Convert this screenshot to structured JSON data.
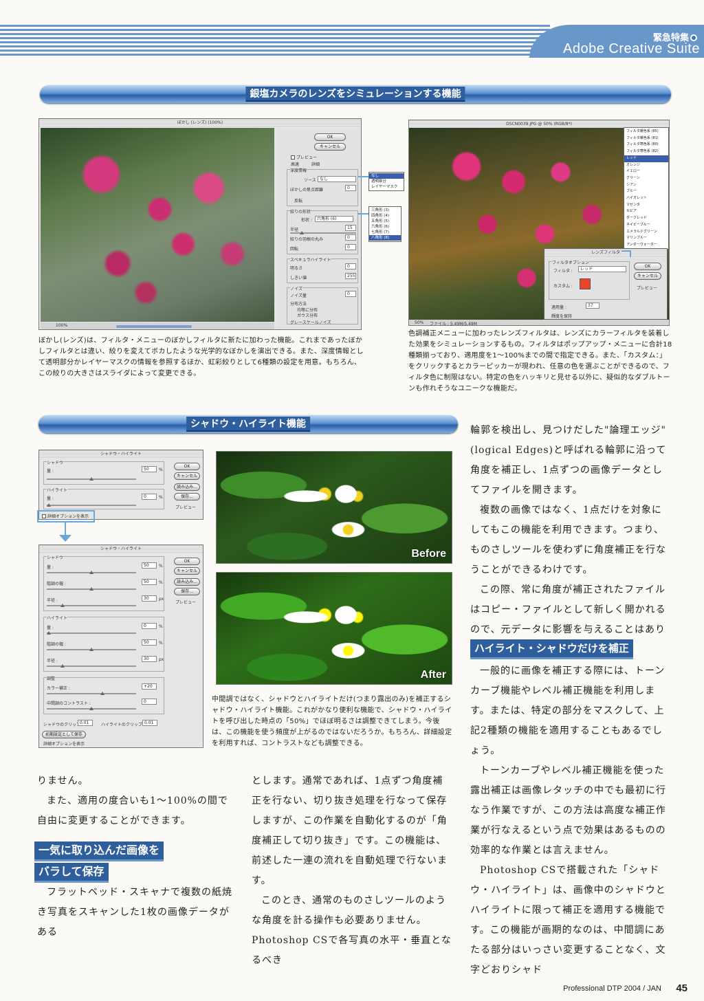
{
  "header": {
    "kicker": "緊急特集",
    "title": "Adobe Creative Suite"
  },
  "section1": {
    "bar_title": "銀塩カメラのレンズをシミュレーションする機能",
    "lens_blur": {
      "window_title": "ぼかし (レンズ) (100%)",
      "ok": "OK",
      "cancel": "キャンセル",
      "preview": "プレビュー",
      "fast": "高速",
      "accurate": "詳細",
      "depth_map_group": "深度情報",
      "source_label": "ソース :",
      "source_value": "なし",
      "focal_distance": "ぼかしの焦点距離",
      "focal_value": "0",
      "invert": "反転",
      "iris_group": "絞りの形状",
      "shape_label": "形状 :",
      "shape_value": "六角形 (6)",
      "radius": "半径",
      "radius_value": "15",
      "blade_curvature": "絞りの羽根の丸み",
      "curvature_value": "0",
      "rotation": "回転",
      "rotation_value": "0",
      "specular_group": "スペキュラハイライト",
      "brightness": "明るさ",
      "brightness_value": "0",
      "threshold": "しきい値",
      "threshold_value": "255",
      "noise_group": "ノイズ",
      "noise_amount": "ノイズ量",
      "noise_value": "0",
      "distribution_group": "分布方法",
      "uniform": "均等に分布",
      "gaussian": "ガウス分布",
      "monochromatic": "グレースケールノイズ",
      "zoom": "100%",
      "source_menu": [
        "なし",
        "透明部分",
        "レイヤーマスク"
      ],
      "shape_menu": [
        "三角形 (3)",
        "四角形 (4)",
        "五角形 (5)",
        "六角形 (6)",
        "七角形 (7)",
        "八角形 (8)"
      ]
    },
    "lens_blur_caption": "ぼかし(レンズ)は、フィルタ・メニューのぼかしフィルタに新たに加わった機能。これまであったぼかしフィルタとは違い、絞りを変えてボカしたような光学的なぼかしを演出できる。また、深度情報として透明部分かレイヤーマスクの情報を参照するほか、虹彩絞りとして6種類の設定を用意。もちろん、この絞りの大きさはスライダによって変更できる。",
    "photo_filter": {
      "window_title": "DSCN0039.JPG @ 50% (RGB/8*)",
      "status": "50%",
      "file_info": "ファイル : 5.49M/5.49M",
      "dialog_title": "レンズフィルタ",
      "option_group": "フィルタオプション",
      "filter_label": "フィルタ :",
      "filter_value": "レッド",
      "custom_label": "カスタム :",
      "custom_color": "#e8452a",
      "density_label": "適用量 :",
      "density_value": "37",
      "preserve": "輝度を保持",
      "ok": "OK",
      "cancel": "キャンセル",
      "preview": "プレビュー",
      "filter_menu": [
        "フィルタ暖色系 (85)",
        "フィルタ暖色系 (81)",
        "フィルタ寒色系 (80)",
        "フィルタ寒色系 (82)",
        "レッド",
        "オレンジ",
        "イエロー",
        "グリーン",
        "シアン",
        "ブルー",
        "バイオレット",
        "マゼンタ",
        "セピア",
        "ダークレッド",
        "ネイビーブルー",
        "エメラルドグリーン",
        "マリンブルー",
        "アンダーウォーター"
      ],
      "filter_menu_selected": "レッド"
    },
    "photo_filter_caption": "色調補正メニューに加わったレンズフィルタは、レンズにカラーフィルタを装着した効果をシミュレーションするもの。フィルタはポップアップ・メニューに合計18種類揃っており、適用度を1〜100%までの間で指定できる。また、「カスタム：」をクリックするとカラーピッカーが現われ、任意の色を選ぶことができるので、フィルタ色に制限はない。特定の色をハッキリと見せる以外に、疑似的なダブルトーンも作れそうなユニークな機能だ。"
  },
  "section2": {
    "bar_title": "シャドウ・ハイライト機能",
    "dialog_simple": {
      "title": "シャドウ・ハイライト",
      "shadow_group": "シャドウ",
      "amount": "量 :",
      "shadow_amount": "50",
      "highlight_group": "ハイライト",
      "highlight_amount": "0",
      "unit_percent": "%",
      "show_more": "詳細オプションを表示",
      "ok": "OK",
      "cancel": "キャンセル",
      "load": "読み込み...",
      "save": "保存...",
      "preview": "プレビュー"
    },
    "dialog_full": {
      "title": "シャドウ・ハイライト",
      "shadow_group": "シャドウ",
      "amount": "量 :",
      "tonal_width": "階調の幅 :",
      "radius": "半径 :",
      "shadow_amount": "50",
      "shadow_width": "50",
      "shadow_radius": "30",
      "highlight_group": "ハイライト",
      "highlight_amount": "0",
      "highlight_width": "50",
      "highlight_radius": "30",
      "unit_px": "px",
      "unit_percent": "%",
      "adjust_group": "調整",
      "color_correction": "カラー補正 :",
      "color_value": "+20",
      "midtone_contrast": "中間調のコントラスト :",
      "midtone_value": "0",
      "shadow_clip": "シャドウのクリップ :",
      "shadow_clip_value": "0.01",
      "highlight_clip": "ハイライトのクリップ :",
      "highlight_clip_value": "0.01",
      "save_default": "初期設定として保存",
      "show_more": "詳細オプションを表示",
      "ok": "OK",
      "cancel": "キャンセル",
      "load": "読み込み...",
      "save": "保存...",
      "preview": "プレビュー"
    },
    "before_label": "Before",
    "after_label": "After",
    "caption": "中間調ではなく、シャドウとハイライトだけ(つまり露出のみ)を補正するシャドウ・ハイライト機能。これがかなり便利な機能で、シャドウ・ハイライトを呼び出した時点の「50%」でほぼ明るさは調整できてしまう。今後は、この機能を使う頻度が上がるのではないだろうか。もちろん、詳細設定を利用すれば、コントラストなども調整できる。"
  },
  "right_column": {
    "p1": "輪郭を検出し、見つけだした\"論理エッジ\"(logical Edges)と呼ばれる輪郭に沿って角度を補正し、1点ずつの画像データとしてファイルを開きます。",
    "p2": "複数の画像ではなく、1点だけを対象にしてもこの機能を利用できます。つまり、ものさしツールを使わずに角度補正を行なうことができるわけです。",
    "p3": "この際、常に角度が補正されたファイルはコピー・ファイルとして新しく開かれるので、元データに影響を与えることはありません。",
    "subhead": "ハイライト・シャドウだけを補正",
    "p4": "一般的に画像を補正する際には、トーンカーブ機能やレベル補正機能を利用します。または、特定の部分をマスクして、上記2種類の機能を適用することもあるでしょう。",
    "p5": "トーンカーブやレベル補正機能を使った露出補正は画像レタッチの中でも最初に行なう作業ですが、この方法は高度な補正作業が行なえるという点で効果はあるものの効率的な作業とは言えません。",
    "p6": "Photoshop CSで搭載された「シャドウ・ハイライト」は、画像中のシャドウとハイライトに限って補正を適用する機能です。この機能が画期的なのは、中間調にあたる部分はいっさい変更することなく、文字どおりシャド"
  },
  "left_column": {
    "p1": "りません。",
    "p2": "また、適用の度合いも1〜100%の間で自由に変更することができます。",
    "subhead_line1": "一気に取り込んだ画像を",
    "subhead_line2": "バラして保存",
    "p3": "フラットベッド・スキャナで複数の紙焼き写真をスキャンした1枚の画像データがある"
  },
  "middle_column": {
    "p1": "とします。通常であれば、1点ずつ角度補正を行ない、切り抜き処理を行なって保存しますが、この作業を自動化するのが「角度補正して切り抜き」です。この機能は、前述した一連の流れを自動処理で行ないます。",
    "p2": "このとき、通常のものさしツールのような角度を計る操作も必要ありません。Photoshop CSで各写真の水平・垂直となるべき"
  },
  "footer": {
    "magazine": "Professional DTP",
    "issue": "2004 / JAN",
    "page": "45"
  }
}
